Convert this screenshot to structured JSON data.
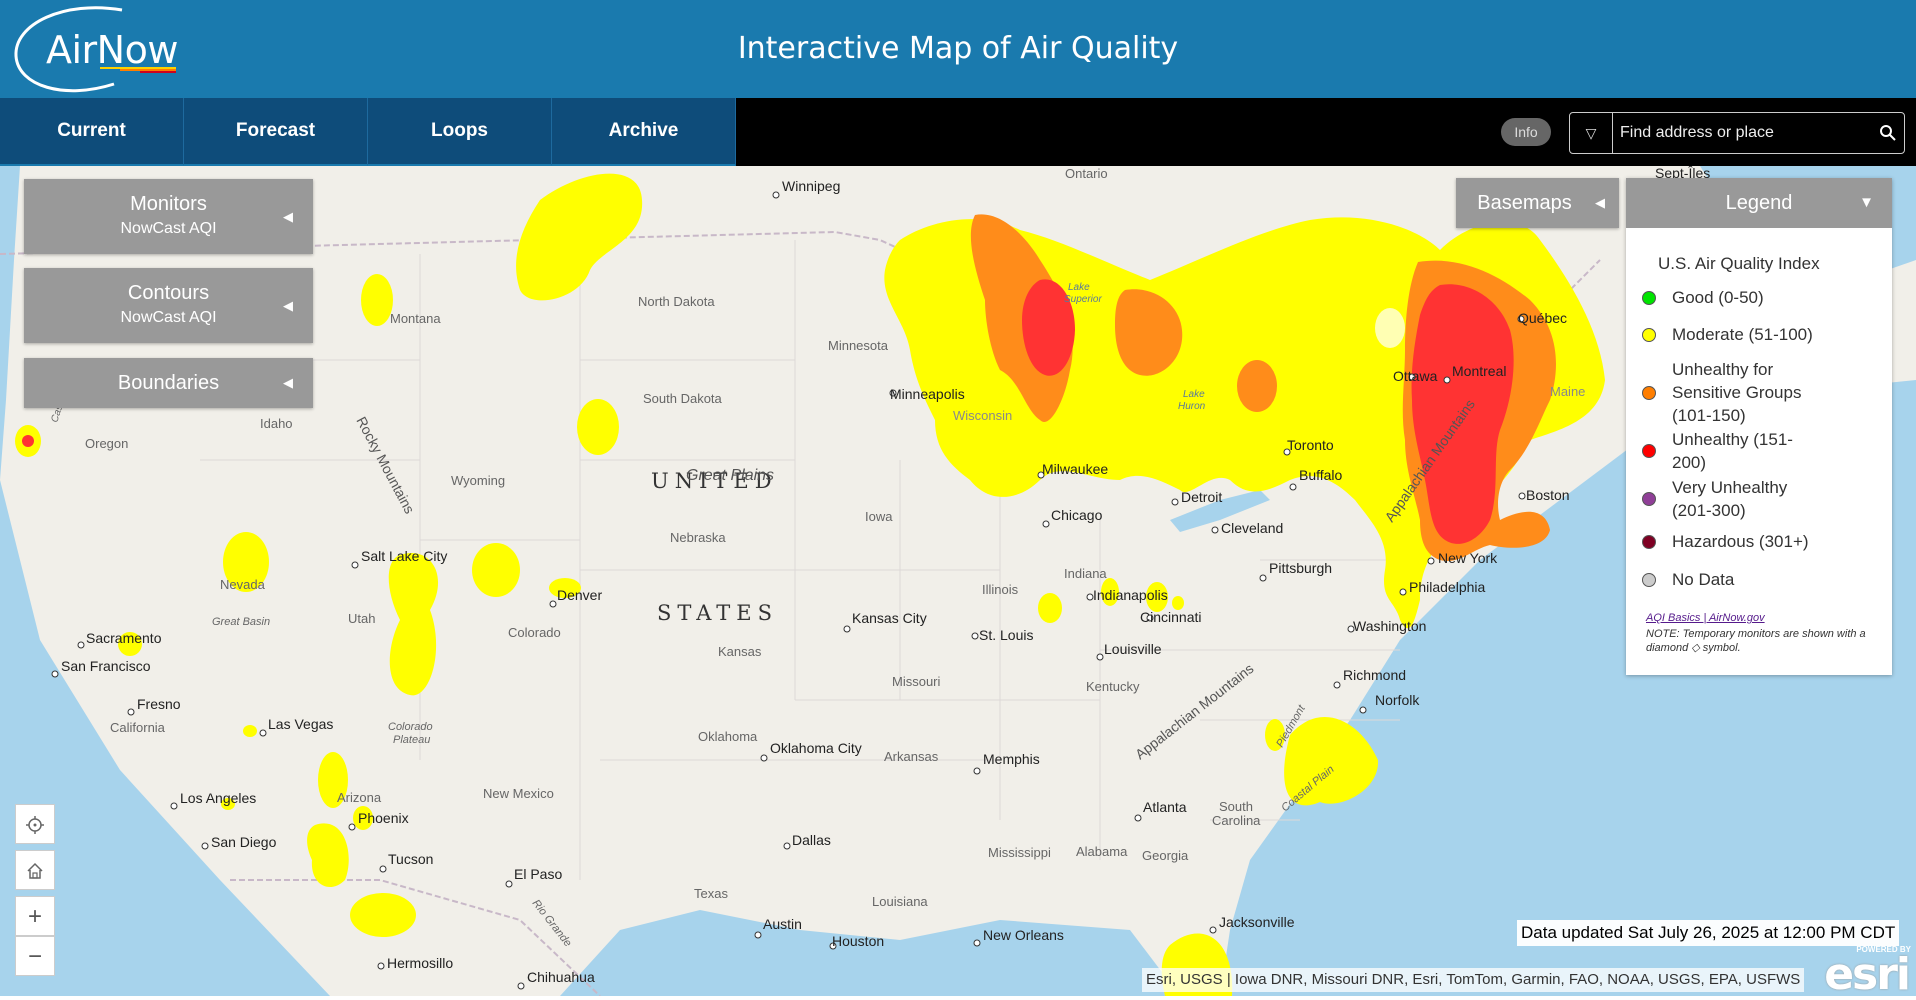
{
  "header": {
    "logo_text": "AirNow",
    "title": "Interactive Map of Air Quality"
  },
  "nav": {
    "tabs": [
      {
        "label": "Current"
      },
      {
        "label": "Forecast"
      },
      {
        "label": "Loops"
      },
      {
        "label": "Archive"
      }
    ],
    "info_label": "Info",
    "search_placeholder": "Find address or place"
  },
  "panels": {
    "monitors": {
      "title": "Monitors",
      "subtitle": "NowCast AQI"
    },
    "contours": {
      "title": "Contours",
      "subtitle": "NowCast AQI"
    },
    "boundaries": {
      "title": "Boundaries"
    },
    "basemaps": {
      "title": "Basemaps"
    }
  },
  "legend": {
    "title": "Legend",
    "subtitle": "U.S. Air Quality Index",
    "items": [
      {
        "label": "Good (0-50)",
        "color": "#00e400"
      },
      {
        "label": "Moderate (51-100)",
        "color": "#ffff00"
      },
      {
        "label": "Unhealthy for Sensitive Groups (101-150)",
        "color": "#ff7e00"
      },
      {
        "label": "Unhealthy (151-200)",
        "color": "#ff0000"
      },
      {
        "label": "Very Unhealthy (201-300)",
        "color": "#8f3f97"
      },
      {
        "label": "Hazardous (301+)",
        "color": "#7e0023"
      },
      {
        "label": "No Data",
        "color": "#cccccc"
      }
    ],
    "link_text": "AQI Basics | AirNow.gov",
    "note": "NOTE: Temporary monitors are shown with a diamond ◇ symbol."
  },
  "map": {
    "data_updated": "Data updated Sat July 26, 2025 at 12:00 PM CDT",
    "attribution": "Esri, USGS | Iowa DNR, Missouri DNR, Esri, TomTom, Garmin, FAO, NOAA, USGS, EPA, USFWS",
    "esri_powered": "POWERED BY",
    "esri_logo": "esri",
    "controls": {
      "locate_icon": "target-icon",
      "home_icon": "home-icon",
      "zoom_in": "+",
      "zoom_out": "−"
    },
    "region_labels": {
      "united": "UNITED",
      "states": "STATES",
      "great_plains": "Great Plains",
      "rocky_mountains": "Rocky Mountains",
      "appalachian_ne": "Appalachian Mountains",
      "appalachian_s": "Appalachian Mountains",
      "great_basin": "Great Basin",
      "colorado_plateau_1": "Colorado",
      "colorado_plateau_2": "Plateau",
      "piedmont": "Piedmont",
      "coastal_plain": "Coastal Plain",
      "rio_grande": "Rio Grande",
      "cascade": "Cascade",
      "lake_superior_1": "Lake",
      "lake_superior_2": "Superior",
      "lake_huron_1": "Lake",
      "lake_huron_2": "Huron"
    },
    "states": {
      "montana": "Montana",
      "north_dakota": "North Dakota",
      "south_dakota": "South Dakota",
      "minnesota": "Minnesota",
      "wisconsin": "Wisconsin",
      "oregon": "Oregon",
      "idaho": "Idaho",
      "wyoming": "Wyoming",
      "nebraska": "Nebraska",
      "iowa": "Iowa",
      "illinois": "Illinois",
      "indiana": "Indiana",
      "nevada": "Nevada",
      "utah": "Utah",
      "colorado": "Colorado",
      "kansas": "Kansas",
      "missouri": "Missouri",
      "kentucky": "Kentucky",
      "california": "California",
      "oklahoma": "Oklahoma",
      "arkansas": "Arkansas",
      "arizona": "Arizona",
      "new_mexico": "New Mexico",
      "mississippi": "Mississippi",
      "alabama": "Alabama",
      "georgia": "Georgia",
      "south_carolina_1": "South",
      "south_carolina_2": "Carolina",
      "texas": "Texas",
      "louisiana": "Louisiana",
      "ontario": "Ontario",
      "maine": "Maine"
    },
    "cities": {
      "winnipeg": "Winnipeg",
      "minneapolis": "Minneapolis",
      "milwaukee": "Milwaukee",
      "chicago": "Chicago",
      "detroit": "Detroit",
      "toronto": "Toronto",
      "buffalo": "Buffalo",
      "ottawa": "Ottawa",
      "montreal": "Montreal",
      "quebec": "Québec",
      "sept_iles": "Sept-Îles",
      "boston": "Boston",
      "new_york": "New York",
      "philadelphia": "Philadelphia",
      "washington": "Washington",
      "cleveland": "Cleveland",
      "pittsburgh": "Pittsburgh",
      "indianapolis": "Indianapolis",
      "cincinnati": "Cincinnati",
      "louisville": "Louisville",
      "st_louis": "St. Louis",
      "kansas_city": "Kansas City",
      "denver": "Denver",
      "salt_lake_city": "Salt Lake City",
      "sacramento": "Sacramento",
      "san_francisco": "San Francisco",
      "fresno": "Fresno",
      "las_vegas": "Las Vegas",
      "los_angeles": "Los Angeles",
      "san_diego": "San Diego",
      "phoenix": "Phoenix",
      "tucson": "Tucson",
      "el_paso": "El Paso",
      "hermosillo": "Hermosillo",
      "chihuahua": "Chihuahua",
      "oklahoma_city": "Oklahoma City",
      "dallas": "Dallas",
      "austin": "Austin",
      "houston": "Houston",
      "new_orleans": "New Orleans",
      "memphis": "Memphis",
      "atlanta": "Atlanta",
      "jacksonville": "Jacksonville",
      "richmond": "Richmond",
      "norfolk": "Norfolk"
    }
  }
}
